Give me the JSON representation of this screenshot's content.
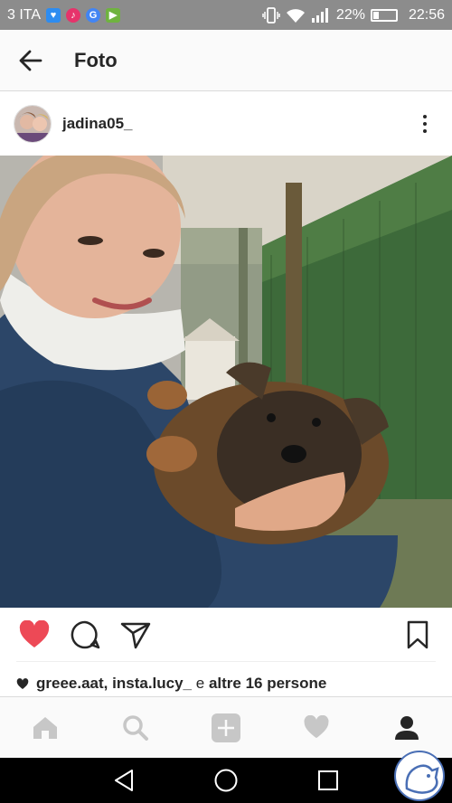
{
  "status_bar": {
    "carrier": "3 ITA",
    "battery_percent_text": "22%",
    "battery_level": 0.22,
    "time": "22:56",
    "icons": [
      "health-app-icon",
      "music-app-icon",
      "google-icon",
      "play-store-icon",
      "vibrate-icon",
      "wifi-icon",
      "signal-icon",
      "battery-icon"
    ]
  },
  "header": {
    "title": "Foto",
    "back_icon": "arrow-left-icon"
  },
  "post": {
    "username": "jadina05_",
    "more_icon": "vertical-dots-icon",
    "photo_description_icon": "photo",
    "liked": true,
    "likes": {
      "user1": "greee.aat",
      "separator": ",",
      "user2": "insta.lucy_",
      "connector": "e",
      "others": "altre 16 persone"
    }
  },
  "actions": {
    "like_icon": "heart-filled-icon",
    "comment_icon": "comment-bubble-icon",
    "share_icon": "send-paper-plane-icon",
    "save_icon": "bookmark-icon"
  },
  "bottom_nav": {
    "items": [
      "home-icon",
      "search-icon",
      "add-post-icon",
      "activity-heart-icon",
      "profile-icon"
    ],
    "active": "profile-icon"
  },
  "system_nav": {
    "items": [
      "back-triangle-icon",
      "home-circle-icon",
      "recents-square-icon"
    ]
  },
  "colors": {
    "status_bar": "#8c8c8c",
    "like_red": "#ed4956",
    "text": "#262626",
    "nav_inactive": "#c7c7c7",
    "nav_active": "#262626"
  }
}
